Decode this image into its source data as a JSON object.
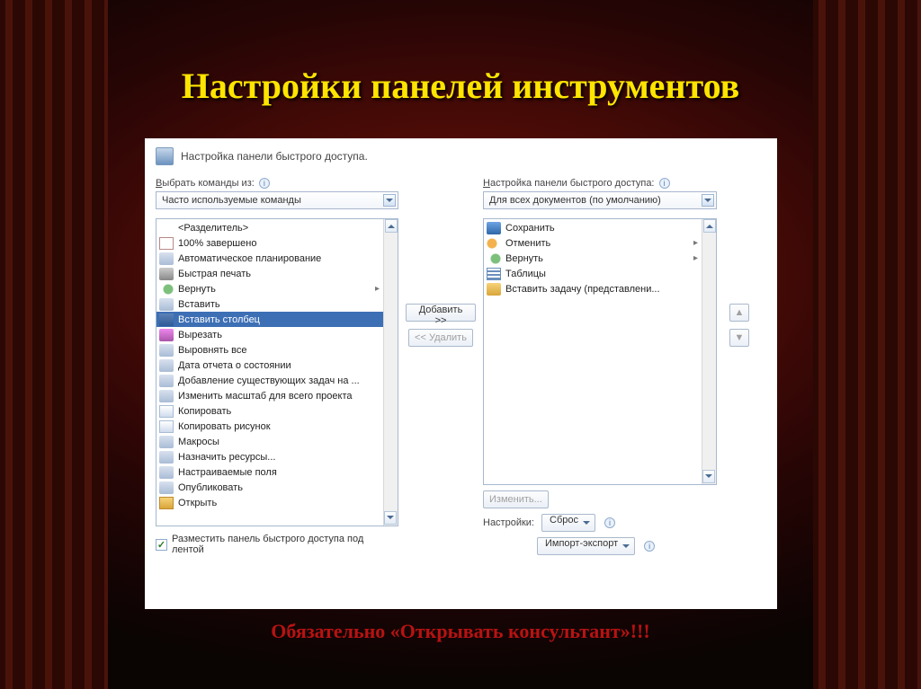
{
  "slide": {
    "title": "Настройки панелей инструментов",
    "caption": "Обязательно «Открывать консультант»!!!"
  },
  "dialog": {
    "title": "Настройка панели быстрого доступа.",
    "left_label_pre": "В",
    "left_label_rest": "ыбрать команды из:",
    "left_dropdown": "Часто используемые команды",
    "right_label_pre": "Н",
    "right_label_rest": "астройка панели быстрого доступа:",
    "right_dropdown": "Для всех документов (по умолчанию)",
    "add_button": "Добавить >>",
    "remove_button": "<< Удалить",
    "show_below_checkbox": "Разместить панель быстрого доступа под лентой",
    "modify_button": "Изменить...",
    "settings_label": "Настройки:",
    "reset_button": "Сброс",
    "import_button": "Импорт-экспорт",
    "left_items": [
      {
        "label": "<Разделитель>",
        "icon": ""
      },
      {
        "label": "100% завершено",
        "icon": "ic-100"
      },
      {
        "label": "Автоматическое планирование",
        "icon": "ic-gen"
      },
      {
        "label": "Быстрая печать",
        "icon": "ic-print"
      },
      {
        "label": "Вернуть",
        "icon": "ic-redo",
        "sub": "▸"
      },
      {
        "label": "Вставить",
        "icon": "ic-gen"
      },
      {
        "label": "Вставить столбец",
        "icon": "ic-col",
        "selected": true
      },
      {
        "label": "Вырезать",
        "icon": "ic-cut"
      },
      {
        "label": "Выровнять все",
        "icon": "ic-gen"
      },
      {
        "label": "Дата отчета о состоянии",
        "icon": "ic-gen"
      },
      {
        "label": "Добавление существующих задач на ...",
        "icon": "ic-gen"
      },
      {
        "label": "Изменить масштаб для всего проекта",
        "icon": "ic-gen"
      },
      {
        "label": "Копировать",
        "icon": "ic-copy"
      },
      {
        "label": "Копировать рисунок",
        "icon": "ic-copy"
      },
      {
        "label": "Макросы",
        "icon": "ic-gen"
      },
      {
        "label": "Назначить ресурсы...",
        "icon": "ic-gen"
      },
      {
        "label": "Настраиваемые поля",
        "icon": "ic-gen"
      },
      {
        "label": "Опубликовать",
        "icon": "ic-gen"
      },
      {
        "label": "Открыть",
        "icon": "ic-open"
      }
    ],
    "right_items": [
      {
        "label": "Сохранить",
        "icon": "ic-save"
      },
      {
        "label": "Отменить",
        "icon": "ic-undo",
        "sub": "▸"
      },
      {
        "label": "Вернуть",
        "icon": "ic-redo",
        "sub": "▸"
      },
      {
        "label": "Таблицы",
        "icon": "ic-table"
      },
      {
        "label": "Вставить задачу (представлени...",
        "icon": "ic-task"
      }
    ]
  }
}
